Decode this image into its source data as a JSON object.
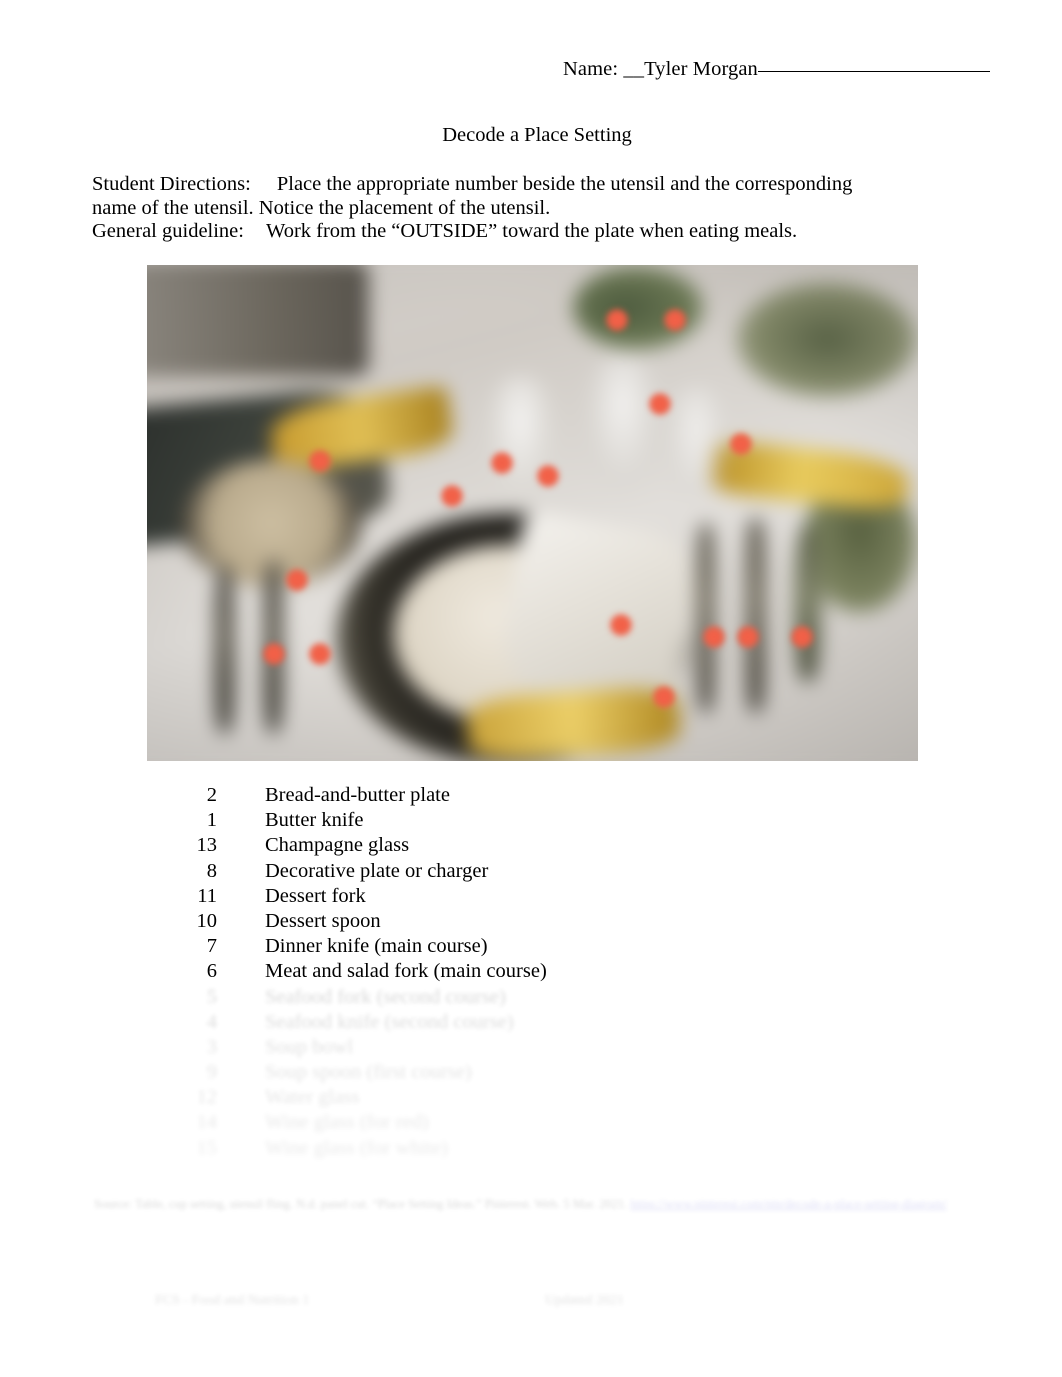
{
  "header": {
    "name_label": "Name:",
    "name_value": "__Tyler Morgan"
  },
  "title": "Decode a Place Setting",
  "directions": {
    "label": "Student Directions:",
    "text": "Place the appropriate number beside the utensil and the corresponding name of the utensil. Notice the placement of the utensil.",
    "guideline_label": "General guideline:",
    "guideline_text": "Work from the “OUTSIDE” toward the plate when eating meals."
  },
  "photo": {
    "alt": "Blurred photograph of a formal place setting with numbered red markers",
    "markers": [
      {
        "x": 61.0,
        "y": 11.0
      },
      {
        "x": 68.5,
        "y": 11.0
      },
      {
        "x": 66.5,
        "y": 28.0
      },
      {
        "x": 77.0,
        "y": 36.0
      },
      {
        "x": 22.5,
        "y": 39.5
      },
      {
        "x": 46.0,
        "y": 40.0
      },
      {
        "x": 52.0,
        "y": 42.5
      },
      {
        "x": 39.5,
        "y": 46.5
      },
      {
        "x": 19.5,
        "y": 63.5
      },
      {
        "x": 16.5,
        "y": 78.5
      },
      {
        "x": 22.5,
        "y": 78.5
      },
      {
        "x": 61.5,
        "y": 72.5
      },
      {
        "x": 73.5,
        "y": 75.0
      },
      {
        "x": 78.0,
        "y": 75.0
      },
      {
        "x": 85.0,
        "y": 75.0
      },
      {
        "x": 67.0,
        "y": 87.0
      }
    ]
  },
  "utensils": [
    {
      "number": "2",
      "name": "Bread-and-butter plate"
    },
    {
      "number": "1",
      "name": "Butter knife"
    },
    {
      "number": "13",
      "name": "Champagne glass"
    },
    {
      "number": "8",
      "name": "Decorative plate or charger"
    },
    {
      "number": "11",
      "name": "Dessert fork"
    },
    {
      "number": "10",
      "name": "Dessert spoon"
    },
    {
      "number": "7",
      "name": "Dinner knife (main course)"
    },
    {
      "number": "6",
      "name": "Meat and salad fork (main course)"
    },
    {
      "number": "5",
      "name": "Seafood fork (second course)"
    },
    {
      "number": "4",
      "name": "Seafood knife (second course)"
    },
    {
      "number": "3",
      "name": "Soup bowl"
    },
    {
      "number": "9",
      "name": "Soup spoon (first course)"
    },
    {
      "number": "12",
      "name": "Water glass"
    },
    {
      "number": "14",
      "name": "Wine glass (for red)"
    },
    {
      "number": "15",
      "name": "Wine glass (for white)"
    }
  ],
  "source_note": {
    "prefix": "Source:",
    "text": "Table, cup setting, utensil fling. N.d. panel cut. “Place Setting Ideas.” Pinterest. Web. 5 Mar. 2021.",
    "link": "https://www.pinterest.com/pin/decode-a-place-setting-diagram/"
  },
  "page_footer": {
    "left": "FCS - Food and Nutrition 1",
    "right": "Updated 2021"
  }
}
